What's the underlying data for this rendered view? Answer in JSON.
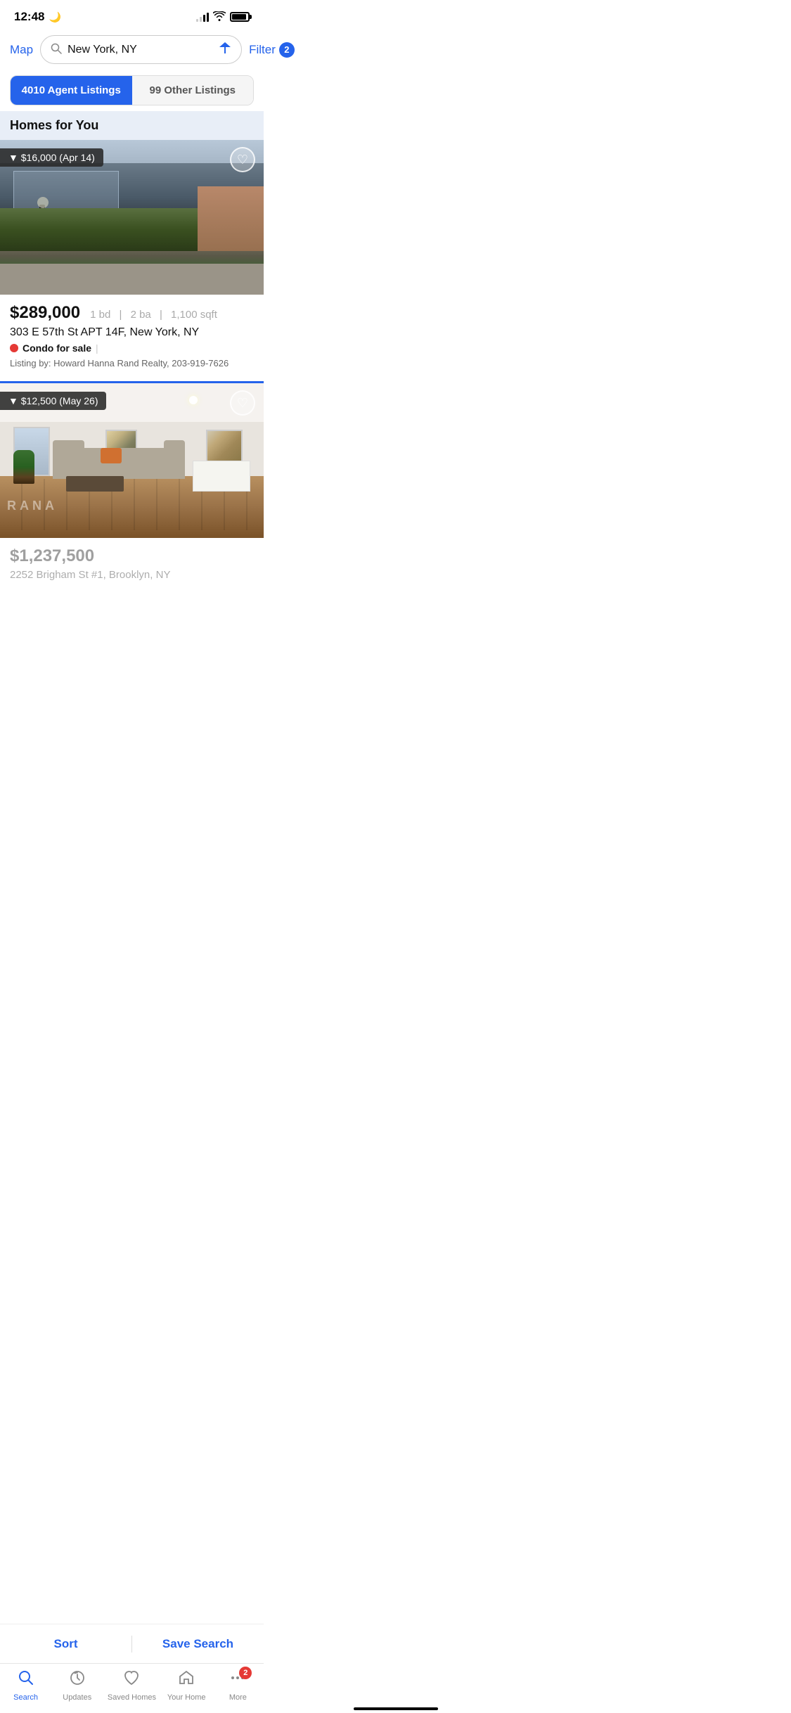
{
  "statusBar": {
    "time": "12:48",
    "moonIcon": "🌙"
  },
  "header": {
    "mapLabel": "Map",
    "searchValue": "New York, NY",
    "filterLabel": "Filter",
    "filterCount": "2"
  },
  "tabs": {
    "agentListings": "4010 Agent Listings",
    "otherListings": "99 Other Listings"
  },
  "sectionHeader": "Homes for You",
  "listings": [
    {
      "priceDrop": "▼ $16,000 (Apr 14)",
      "price": "$289,000",
      "beds": "1 bd",
      "baths": "2 ba",
      "sqft": "1,100 sqft",
      "address": "303 E 57th St APT 14F, New York, NY",
      "typeLabel": "Condo for sale",
      "agentInfo": "Listing by: Howard Hanna Rand Realty, 203-919-7626"
    },
    {
      "priceDrop": "▼ $12,500 (May 26)",
      "price": "$1,237,500",
      "address": "2252 Brigham St #1, Brooklyn, NY"
    }
  ],
  "bottomBar": {
    "sortLabel": "Sort",
    "saveSearchLabel": "Save Search"
  },
  "bottomNav": {
    "items": [
      {
        "id": "search",
        "label": "Search",
        "active": true
      },
      {
        "id": "updates",
        "label": "Updates",
        "active": false
      },
      {
        "id": "saved-homes",
        "label": "Saved Homes",
        "active": false
      },
      {
        "id": "your-home",
        "label": "Your Home",
        "active": false
      },
      {
        "id": "more",
        "label": "More",
        "active": false,
        "badge": "2"
      }
    ]
  }
}
